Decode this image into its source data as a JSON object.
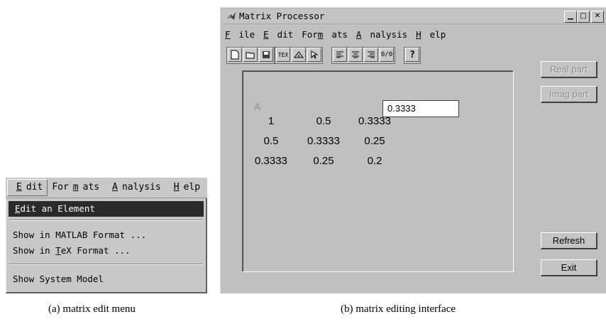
{
  "menu_a": {
    "bar": [
      "Edit",
      "Formats",
      "Analysis",
      "Help"
    ],
    "items": [
      "Edit an Element",
      "Show in MATLAB Format ...",
      "Show in TeX Format ...",
      "Show System Model"
    ]
  },
  "window": {
    "title": "Matrix Processor",
    "menu": [
      "File",
      "Edit",
      "Formats",
      "Analysis",
      "Help"
    ],
    "toolbar_icons": [
      "new-icon",
      "open-icon",
      "save-icon",
      "tex-icon",
      "model-icon",
      "pointer-icon",
      "align-left-icon",
      "align-center-icon",
      "align-right-icon",
      "fraction-icon",
      "help-icon"
    ],
    "matrix_name": "A",
    "matrix": [
      [
        "1",
        "0.5",
        "0.3333"
      ],
      [
        "0.5",
        "0.3333",
        "0.25"
      ],
      [
        "0.3333",
        "0.25",
        "0.2"
      ]
    ],
    "edit_value": "0.3333",
    "buttons": {
      "real": "Real part",
      "imag": "Imag part",
      "refresh": "Refresh",
      "exit": "Exit"
    }
  },
  "captions": {
    "a": "(a) matrix edit menu",
    "b": "(b) matrix editing interface"
  }
}
